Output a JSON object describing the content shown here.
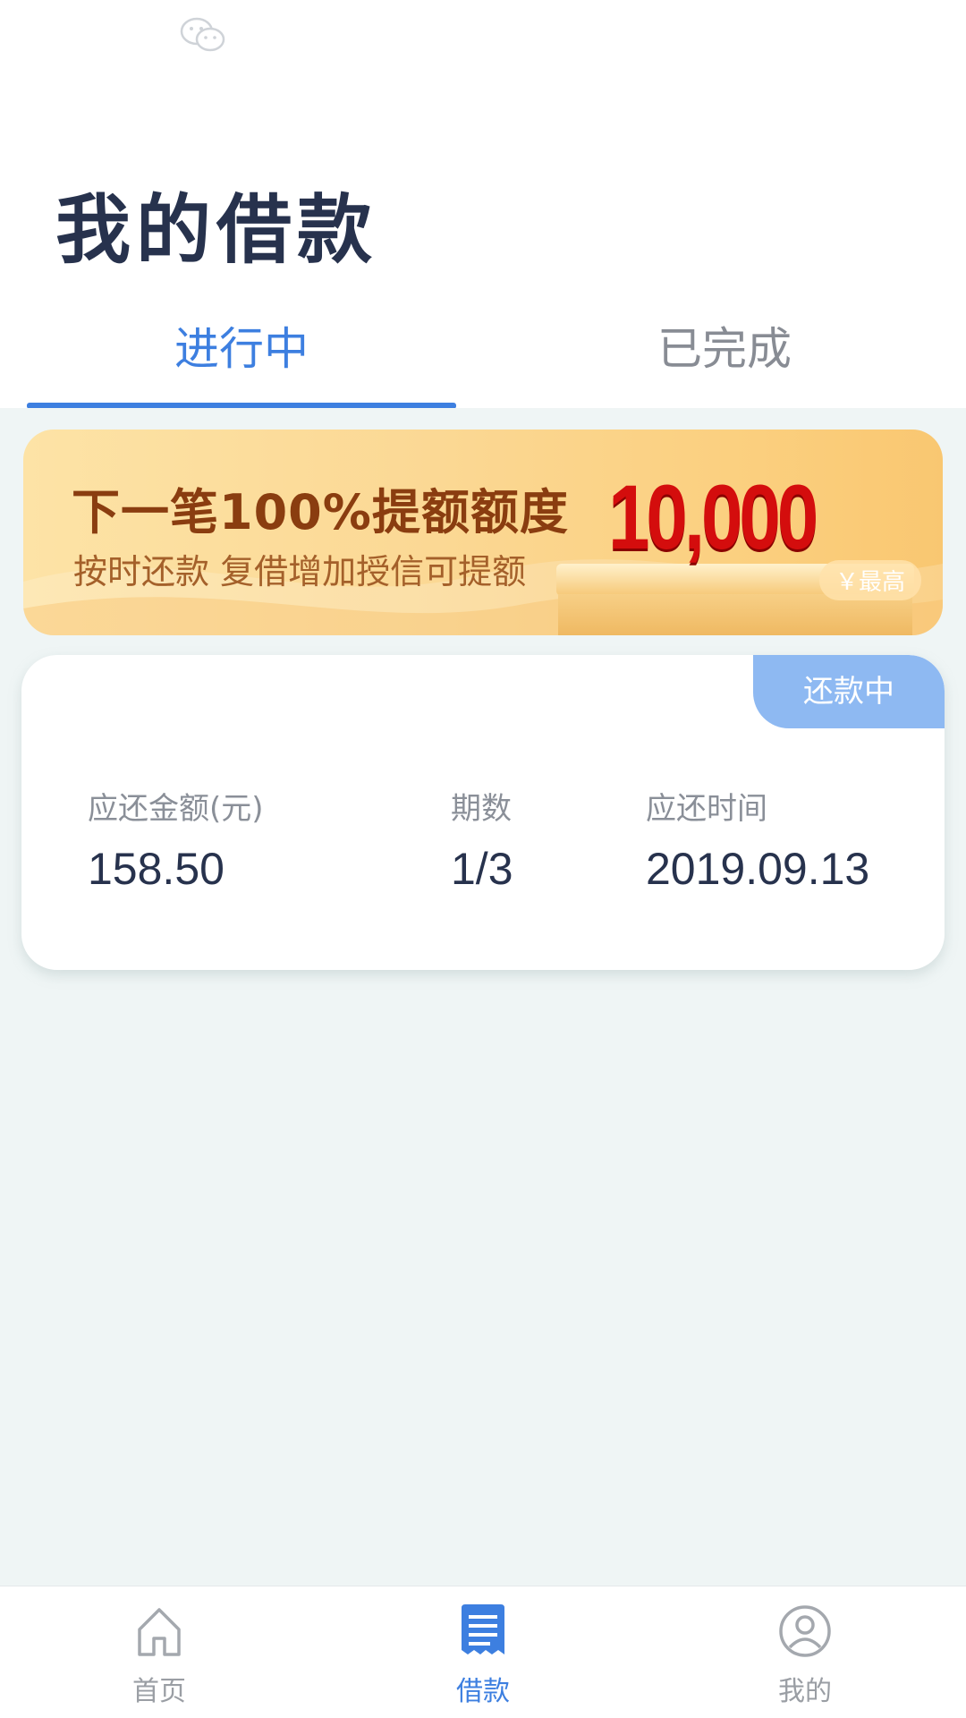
{
  "page": {
    "title": "我的借款"
  },
  "status_bar": {
    "icon": "wechat-icon"
  },
  "tabs": [
    {
      "label": "进行中",
      "active": true
    },
    {
      "label": "已完成",
      "active": false
    }
  ],
  "banner": {
    "headline": "下一笔100%提额额度",
    "subline": "按时还款  复借增加授信可提额",
    "amount": "10,000",
    "amount_tag": "￥最高"
  },
  "loan_card": {
    "status": "还款中",
    "fields": [
      {
        "label": "应还金额(元)",
        "value": "158.50"
      },
      {
        "label": "期数",
        "value": "1/3"
      },
      {
        "label": "应还时间",
        "value": "2019.09.13"
      }
    ]
  },
  "bottom_nav": {
    "items": [
      {
        "label": "首页",
        "icon": "home-icon",
        "active": false
      },
      {
        "label": "借款",
        "icon": "loan-document-icon",
        "active": true
      },
      {
        "label": "我的",
        "icon": "user-profile-icon",
        "active": false
      }
    ]
  },
  "colors": {
    "accent": "#3d7fe0",
    "title": "#27324d",
    "badge": "#8eb9f2",
    "amount_red": "#d40d0d",
    "background": "#eff5f5"
  }
}
